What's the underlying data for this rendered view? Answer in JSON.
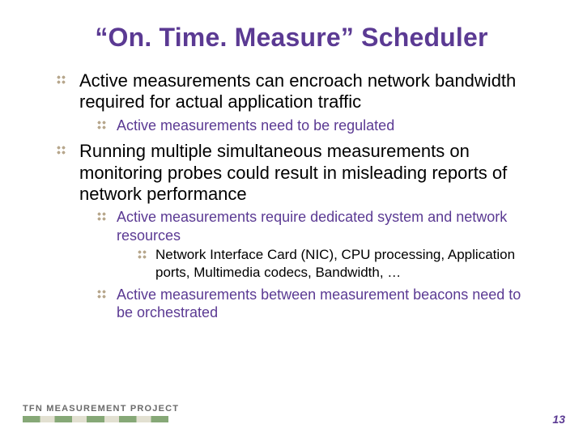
{
  "title": "“On. Time. Measure” Scheduler",
  "bullets": [
    {
      "text": "Active measurements can encroach network bandwidth required for actual application traffic",
      "children": [
        {
          "text": "Active measurements need to be regulated"
        }
      ]
    },
    {
      "text": " Running multiple simultaneous measurements on monitoring probes could result in misleading reports of network performance",
      "children": [
        {
          "text": "Active measurements require dedicated system and network resources",
          "children": [
            {
              "text": "Network Interface Card (NIC), CPU processing, Application ports, Multimedia codecs, Bandwidth, …"
            }
          ]
        },
        {
          "text": "Active measurements between measurement beacons need to be orchestrated"
        }
      ]
    }
  ],
  "footer": {
    "logo_text": "TFN MEASUREMENT PROJECT",
    "page_number": "13"
  }
}
